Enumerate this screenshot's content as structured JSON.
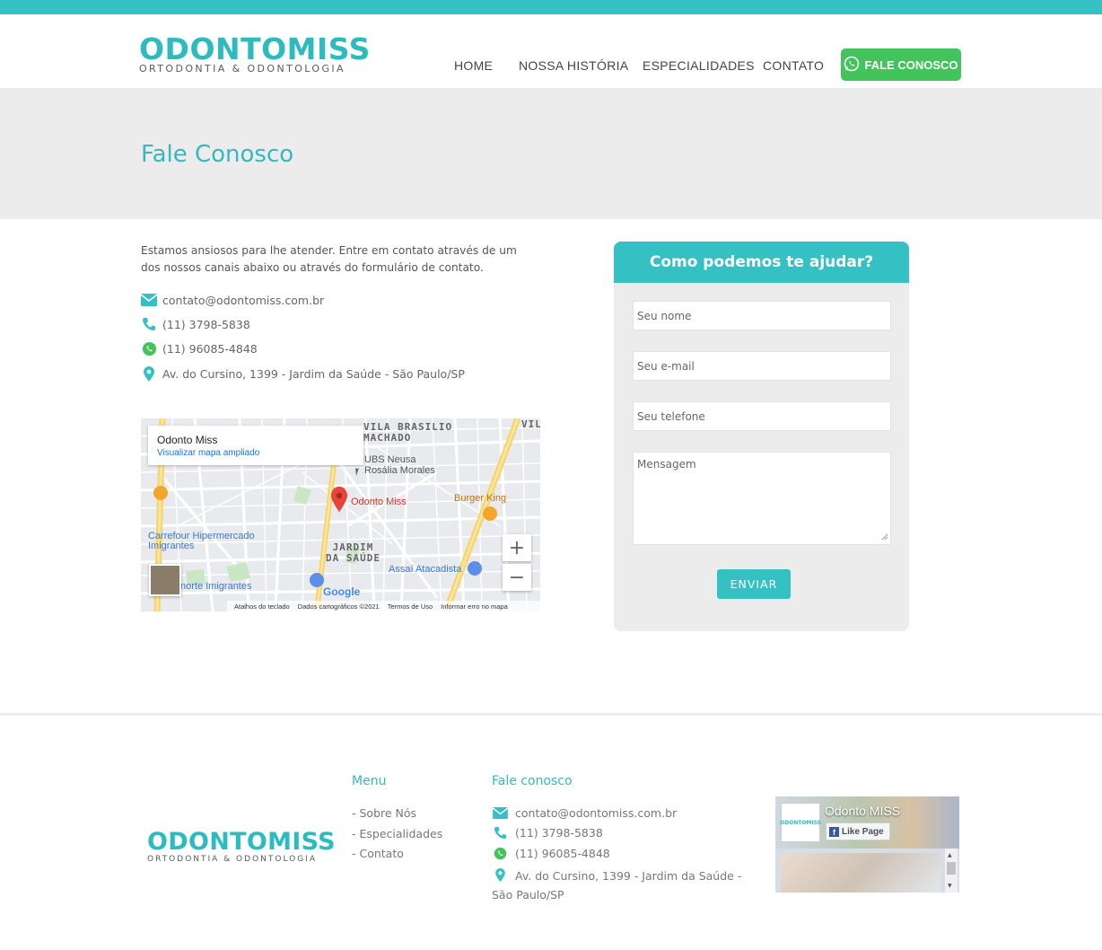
{
  "brand": {
    "name": "ODONTOMISS",
    "tagline": "ORTODONTIA & ODONTOLOGIA",
    "accent": "#35c1c3",
    "whatsapp_green": "#43c35c"
  },
  "nav": {
    "items": [
      "HOME",
      "NOSSA HISTÓRIA",
      "ESPECIALIDADES",
      "CONTATO"
    ],
    "cta_label": "FALE CONOSCO"
  },
  "hero": {
    "title": "Fale Conosco"
  },
  "contact": {
    "intro": "Estamos ansiosos para lhe atender. Entre em contato através de um dos nossos canais abaixo ou através do formulário de contato.",
    "email": "contato@odontomiss.com.br",
    "phone": "(11) 3798-5838",
    "whatsapp": "(11) 96085-4848",
    "address": "Av. do Cursino, 1399 - Jardim da Saúde - São Paulo/SP"
  },
  "map": {
    "place_name": "Odonto Miss",
    "view_larger": "Visualizar mapa ampliado",
    "pin_label": "Odonto Miss",
    "labels": {
      "vila": "VILA BRASILIO\nMACHADO",
      "vil": "VIL",
      "ubs": "UBS Neusa\nRosália Morales",
      "burger": "Burger King",
      "carrefour": "Carrefour Hipermercado\nImigrantes",
      "jardim": "JARDIM\nDA SAÚDE",
      "assai": "Assaí Atacadista",
      "norte": "norte Imigrantes",
      "google": "Google"
    },
    "zoom_in": "+",
    "zoom_out": "−",
    "footer": [
      "Atalhos do teclado",
      "Dados cartográficos ©2021",
      "Termos de Uso",
      "Informar erro no mapa"
    ]
  },
  "form": {
    "heading": "Como podemos te ajudar?",
    "name_placeholder": "Seu nome",
    "email_placeholder": "Seu e-mail",
    "phone_placeholder": "Seu telefone",
    "message_placeholder": "Mensagem",
    "submit_label": "ENVIAR"
  },
  "footer": {
    "menu_title": "Menu",
    "menu_items": [
      "- Sobre Nós",
      "- Especialidades",
      "- Contato"
    ],
    "contact_title": "Fale conosco",
    "email": "contato@odontomiss.com.br",
    "phone": "(11) 3798-5838",
    "whatsapp": "(11) 96085-4848",
    "address": "Av. do Cursino, 1399 - Jardim da Saúde - São Paulo/SP",
    "facebook": {
      "page_name": "Odonto MISS",
      "like_label": "Like Page"
    }
  }
}
